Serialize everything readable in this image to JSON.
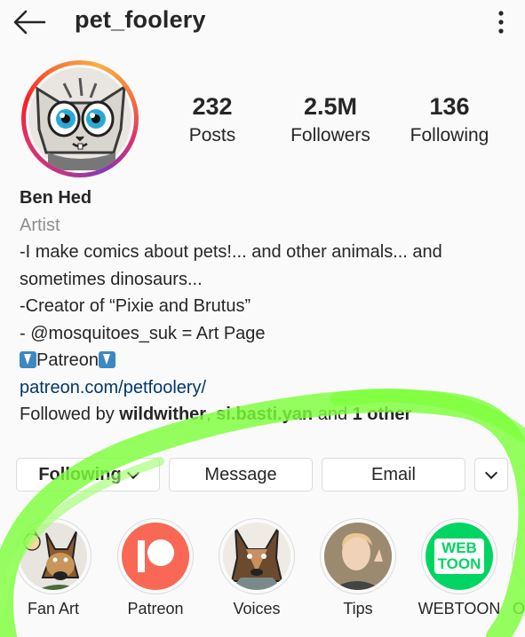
{
  "header": {
    "username": "pet_foolery",
    "back_icon": "arrow-left-icon",
    "more_icon": "more-vertical-icon"
  },
  "stats": [
    {
      "value": "232",
      "label": "Posts"
    },
    {
      "value": "2.5M",
      "label": "Followers"
    },
    {
      "value": "136",
      "label": "Following"
    }
  ],
  "bio": {
    "name": "Ben Hed",
    "category": "Artist",
    "line1": "-I make comics about pets!... and other animals... and",
    "line2": "sometimes dinosaurs...",
    "line3": "-Creator of “Pixie and Brutus”",
    "line4": "- @mosquitoes_suk = Art Page",
    "patreon_text": "Patreon",
    "link": "patreon.com/petfoolery/",
    "followed_by_prefix": "Followed by ",
    "follower1": "wildwither",
    "separator": ", ",
    "follower2": "si.basti.yan",
    "and_text": " and ",
    "others": "1 other"
  },
  "buttons": {
    "following": "Following",
    "message": "Message",
    "email": "Email"
  },
  "highlights": [
    {
      "label": "Fan Art"
    },
    {
      "label": "Patreon"
    },
    {
      "label": "Voices"
    },
    {
      "label": "Tips"
    },
    {
      "label": "WEBTOON",
      "logo_line1": "WEB",
      "logo_line2": "TOON"
    },
    {
      "label": "O"
    }
  ],
  "colors": {
    "link": "#00376b",
    "secondary_text": "#8e8e8e",
    "patreon": "#f96854",
    "webtoon": "#00d564",
    "annotation": "#7cff3a",
    "story_ring_start": "#c13584",
    "story_ring_end": "#fcaf45"
  }
}
